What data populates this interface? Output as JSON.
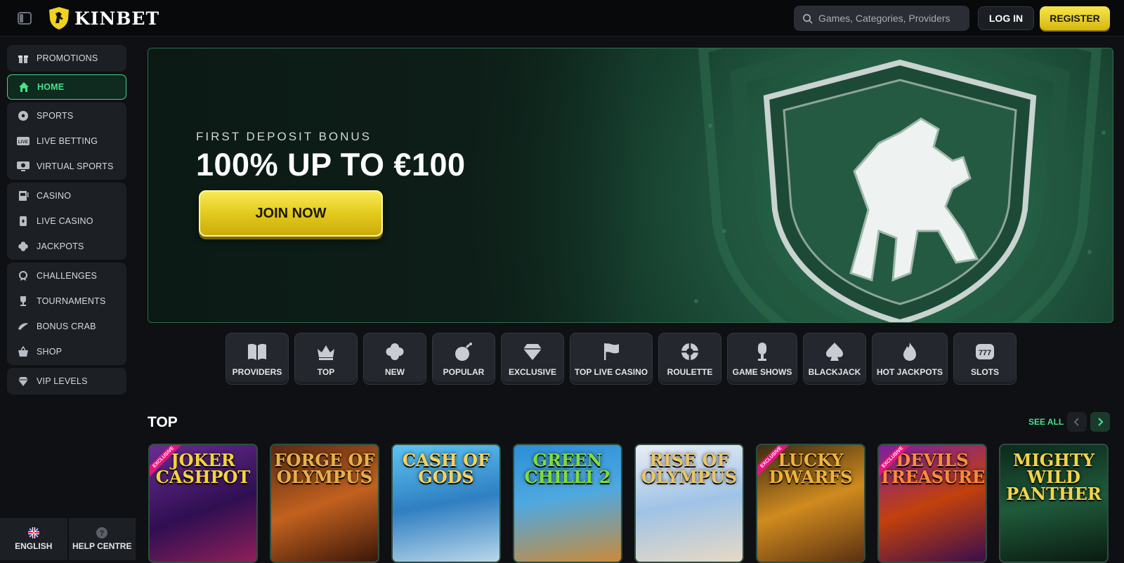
{
  "header": {
    "brand": "KINBET",
    "search_placeholder": "Games, Categories, Providers",
    "login_label": "LOG IN",
    "register_label": "REGISTER"
  },
  "sidebar": {
    "groups": [
      [
        {
          "label": "PROMOTIONS",
          "icon": "gift-icon"
        }
      ],
      [
        {
          "label": "HOME",
          "icon": "home-icon",
          "active": true
        }
      ],
      [
        {
          "label": "SPORTS",
          "icon": "soccer-ball-icon"
        },
        {
          "label": "LIVE BETTING",
          "icon": "live-icon"
        },
        {
          "label": "VIRTUAL SPORTS",
          "icon": "virtual-sports-icon"
        }
      ],
      [
        {
          "label": "CASINO",
          "icon": "slot-machine-icon"
        },
        {
          "label": "LIVE CASINO",
          "icon": "card-icon"
        },
        {
          "label": "JACKPOTS",
          "icon": "clover-icon"
        }
      ],
      [
        {
          "label": "CHALLENGES",
          "icon": "medal-icon"
        },
        {
          "label": "TOURNAMENTS",
          "icon": "trophy-icon"
        },
        {
          "label": "BONUS CRAB",
          "icon": "crab-icon"
        },
        {
          "label": "SHOP",
          "icon": "basket-icon"
        }
      ],
      [
        {
          "label": "VIP LEVELS",
          "icon": "diamond-icon"
        }
      ]
    ],
    "language_label": "ENGLISH",
    "help_label": "HELP CENTRE"
  },
  "banner": {
    "subtitle": "FIRST DEPOSIT BONUS",
    "title": "100% UP TO €100",
    "cta_label": "JOIN NOW"
  },
  "categories": [
    {
      "label": "PROVIDERS",
      "icon": "book-icon"
    },
    {
      "label": "TOP",
      "icon": "crown-icon"
    },
    {
      "label": "NEW",
      "icon": "clover-icon"
    },
    {
      "label": "POPULAR",
      "icon": "bomb-icon"
    },
    {
      "label": "EXCLUSIVE",
      "icon": "diamond-icon"
    },
    {
      "label": "TOP LIVE CASINO",
      "icon": "flag-icon"
    },
    {
      "label": "ROULETTE",
      "icon": "roulette-icon"
    },
    {
      "label": "GAME SHOWS",
      "icon": "microphone-icon"
    },
    {
      "label": "BLACKJACK",
      "icon": "spade-icon"
    },
    {
      "label": "HOT JACKPOTS",
      "icon": "flame-icon"
    },
    {
      "label": "SLOTS",
      "icon": "slots-777-icon"
    }
  ],
  "top_section": {
    "title": "TOP",
    "see_all_label": "SEE ALL",
    "exclusive_label": "EXCLUSIVE",
    "games": [
      {
        "title": "JOKER CASHPOT",
        "exclusive": true
      },
      {
        "title": "FORGE OF OLYMPUS",
        "exclusive": false
      },
      {
        "title": "CASH OF GODS",
        "exclusive": false
      },
      {
        "title": "GREEN CHILLI 2",
        "exclusive": false
      },
      {
        "title": "RISE OF OLYMPUS",
        "exclusive": false
      },
      {
        "title": "LUCKY DWARFS",
        "exclusive": true
      },
      {
        "title": "DEVILS TREASURES",
        "exclusive": true
      },
      {
        "title": "MIGHTY WILD PANTHER",
        "exclusive": false
      }
    ]
  },
  "colors": {
    "accent_green": "#46e08f",
    "cta_yellow": "#e1c719",
    "background": "#0e1013",
    "panel": "#1c1f24"
  }
}
